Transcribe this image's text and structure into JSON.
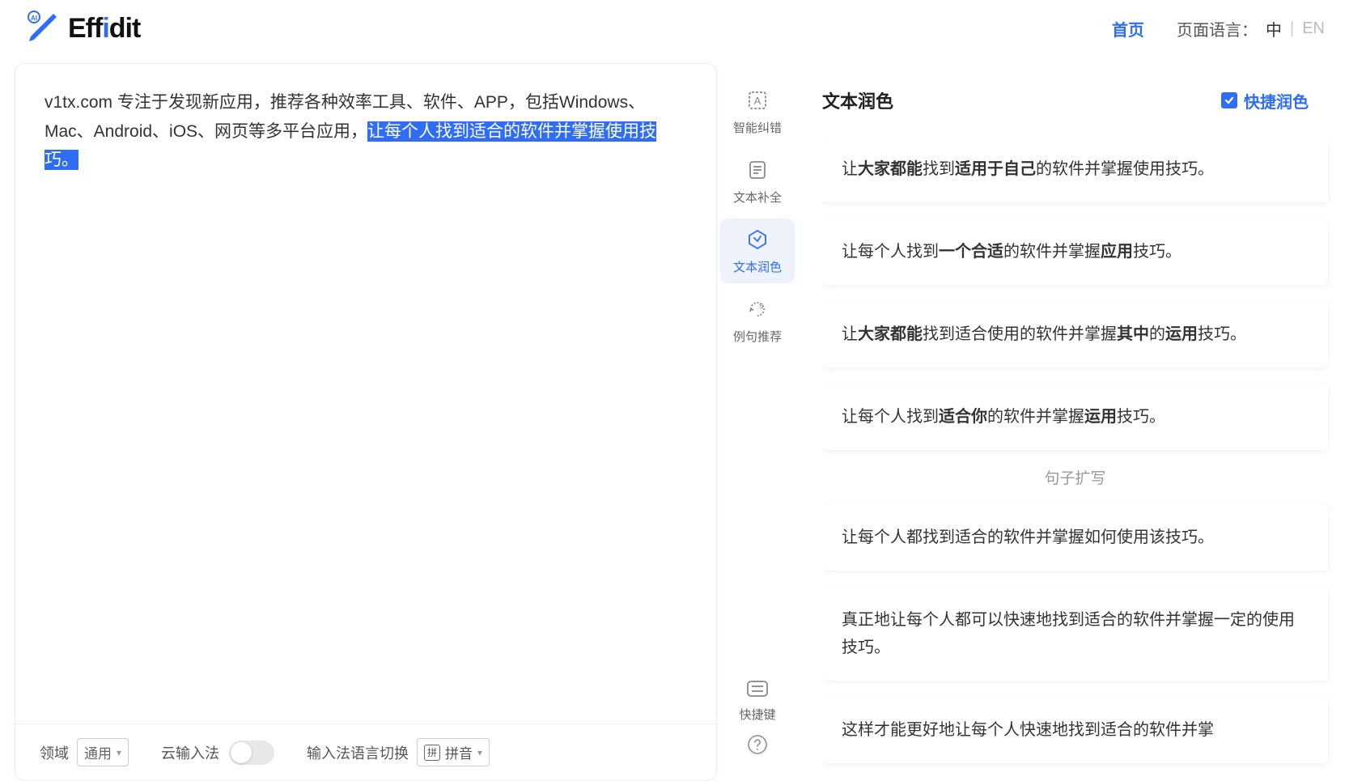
{
  "header": {
    "logo_text_eff": "Eff",
    "logo_text_i": "i",
    "logo_text_dit": "dit",
    "home": "首页",
    "lang_label": "页面语言：",
    "lang_cn": "中",
    "lang_en": "EN"
  },
  "editor": {
    "text_plain": "v1tx.com 专注于发现新应用，推荐各种效率工具、软件、APP，包括Windows、Mac、Android、iOS、网页等多平台应用，",
    "text_highlight": "让每个人找到适合的软件并掌握使用技巧。"
  },
  "footer": {
    "domain_label": "领域",
    "domain_value": "通用",
    "cloud_ime": "云输入法",
    "ime_switch": "输入法语言切换",
    "pinyin": "拼音"
  },
  "sidebar": {
    "items": [
      {
        "label": "智能纠错"
      },
      {
        "label": "文本补全"
      },
      {
        "label": "文本润色"
      },
      {
        "label": "例句推荐"
      }
    ],
    "shortcut": "快捷键"
  },
  "panel": {
    "title": "文本润色",
    "quick": "快捷润色",
    "section_expand": "句子扩写",
    "results": [
      {
        "html": "让<b>大家都能</b>找到<b>适用于自己</b>的软件并掌握使用技巧。"
      },
      {
        "html": "让每个人找到<b>一个合适</b>的软件并掌握<b>应用</b>技巧。"
      },
      {
        "html": "让<b>大家都能</b>找到适合使用的软件并掌握<b>其中</b>的<b>运用</b>技巧。"
      },
      {
        "html": "让每个人找到<b>适合你</b>的软件并掌握<b>运用</b>技巧。"
      }
    ],
    "expand_results": [
      {
        "html": "让每个人都找到适合的软件并掌握如何使用该技巧。"
      },
      {
        "html": "真正地让每个人都可以快速地找到适合的软件并掌握一定的使用技巧。"
      },
      {
        "html": "这样才能更好地让每个人快速地找到适合的软件并掌"
      }
    ]
  }
}
